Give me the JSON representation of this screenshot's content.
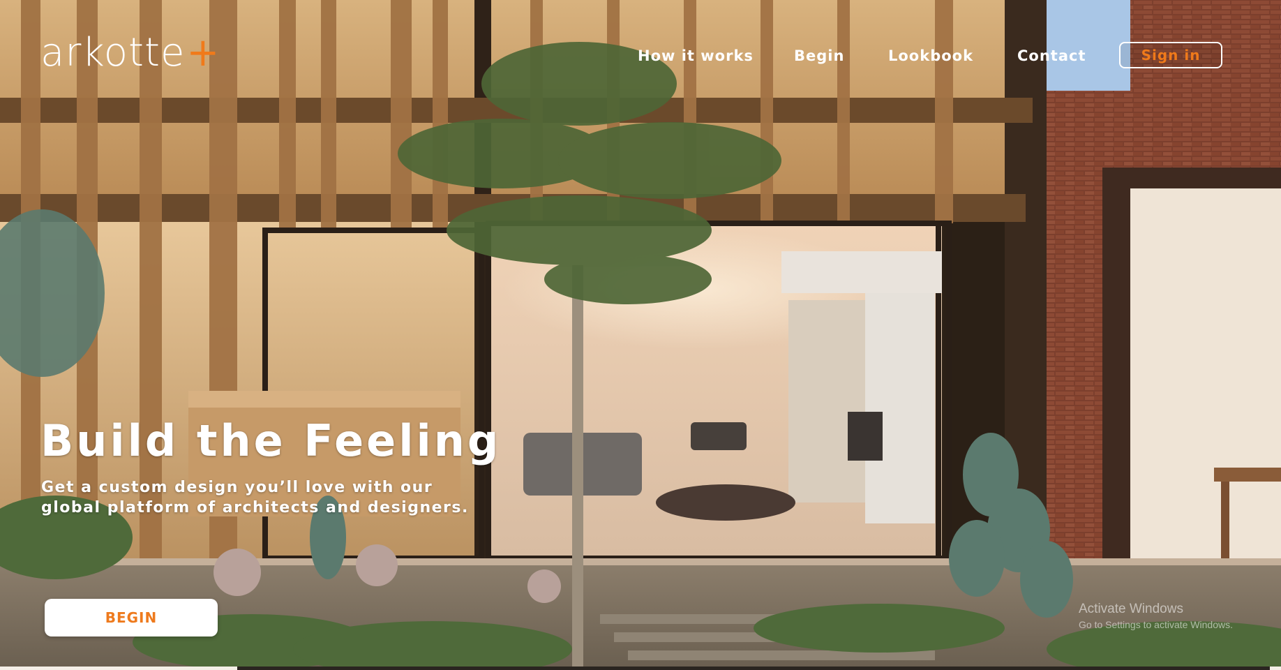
{
  "brand": {
    "name": "arkotte",
    "plus": "+",
    "accent_color": "#f07a1a"
  },
  "nav": {
    "links": [
      "How it works",
      "Begin",
      "Lookbook",
      "Contact"
    ],
    "sign_in": "Sign in"
  },
  "hero": {
    "headline": "Build the Feeling",
    "subtitle": "Get a custom design you’ll love with our global platform of architects and designers.",
    "cta": "BEGIN",
    "image": "modern-courtyard-house-photo"
  },
  "os_watermark": {
    "title": "Activate Windows",
    "subtitle": "Go to Settings to activate Windows."
  }
}
